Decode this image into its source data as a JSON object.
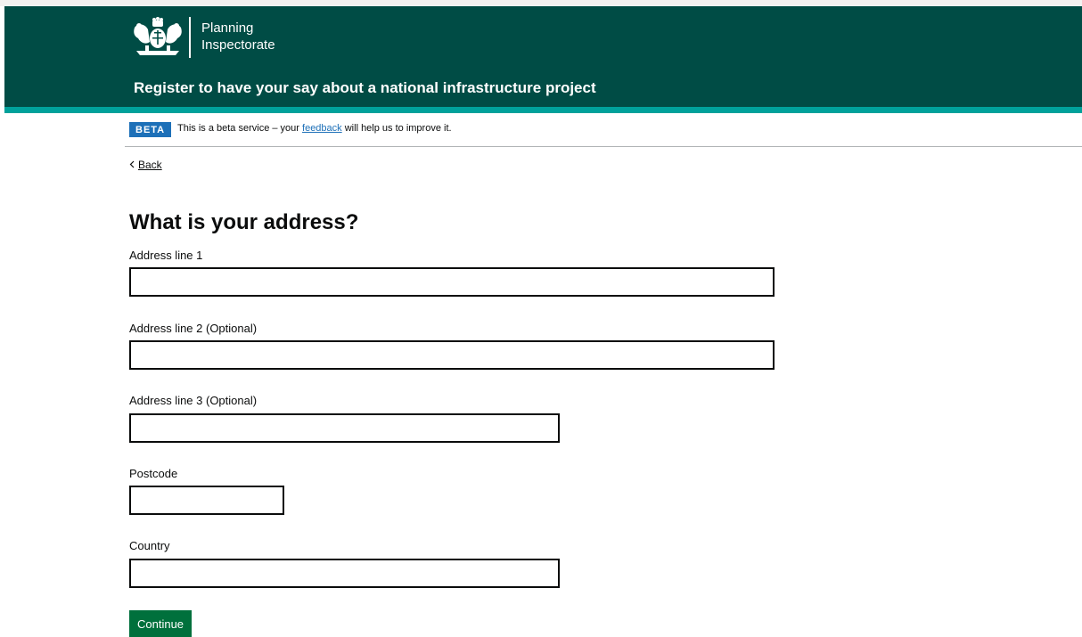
{
  "header": {
    "org_name_line1": "Planning",
    "org_name_line2": "Inspectorate",
    "service_name": "Register to have your say about a national infrastructure project",
    "logo_icon": "royal-coat-of-arms-icon",
    "brand_color": "#004c45",
    "accent_color": "#00a19b"
  },
  "phase_banner": {
    "tag": "BETA",
    "text_before": "This is a beta service – your",
    "link_text": "feedback",
    "text_after": "will help us to improve it."
  },
  "back_link": {
    "icon": "chevron-left-icon",
    "label": "Back"
  },
  "page": {
    "title": "What is your address?"
  },
  "form": {
    "address_line_1": {
      "label": "Address line 1",
      "value": ""
    },
    "address_line_2": {
      "label": "Address line 2 (Optional)",
      "value": ""
    },
    "address_line_3": {
      "label": "Address line 3 (Optional)",
      "value": ""
    },
    "postcode": {
      "label": "Postcode",
      "value": ""
    },
    "country": {
      "label": "Country",
      "value": ""
    },
    "continue_label": "Continue",
    "button_color": "#00703c"
  }
}
